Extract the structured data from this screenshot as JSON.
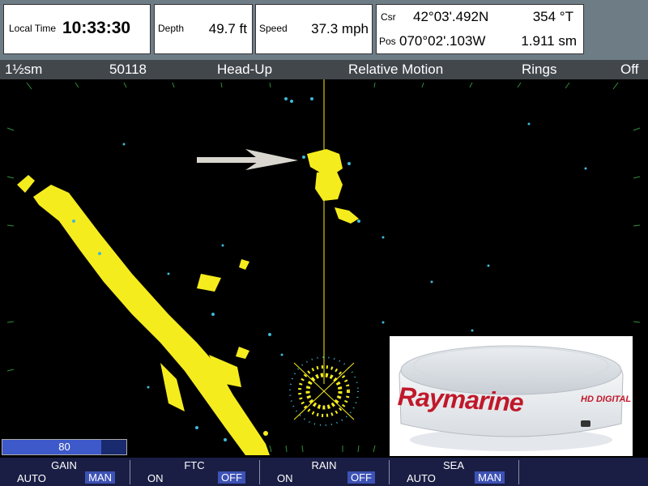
{
  "databar": {
    "time_label": "Local Time",
    "time_value": "10:33:30",
    "depth_label": "Depth",
    "depth_value": "49.7 ft",
    "speed_label": "Speed",
    "speed_value": "37.3 mph",
    "csr_label": "Csr",
    "csr_lat": "42°03'.492N",
    "csr_bearing": "354 °T",
    "pos_label": "Pos",
    "pos_lon": "070°02'.103W",
    "pos_range": "1.911 sm"
  },
  "status": {
    "range": "1½sm",
    "code": "50118",
    "orientation": "Head-Up",
    "motion": "Relative Motion",
    "rings_label": "Rings",
    "rings_value": "Off"
  },
  "gain_slider": {
    "value": "80",
    "level_percent": 80
  },
  "softkeys": [
    {
      "title": "GAIN",
      "opt1": "AUTO",
      "opt2": "MAN"
    },
    {
      "title": "FTC",
      "opt1": "ON",
      "opt2": "OFF"
    },
    {
      "title": "RAIN",
      "opt1": "ON",
      "opt2": "OFF"
    },
    {
      "title": "SEA",
      "opt1": "AUTO",
      "opt2": "MAN"
    }
  ],
  "inset": {
    "brand": "Raymarine",
    "product": "HD DIGITAL"
  },
  "colors": {
    "echo": "#f5ec1e",
    "echo_weak": "#3fb8d8",
    "softkey_bg": "#1a1e44",
    "softkey_active": "#3d52b5"
  },
  "icons": {
    "arrow": "white-arrow-icon"
  }
}
